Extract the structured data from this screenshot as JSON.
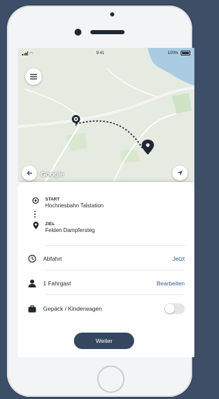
{
  "colors": {
    "primary": "#34475f",
    "link": "#3a5a8c",
    "background": "#3d4f66"
  },
  "status_bar": {
    "time": "9:41",
    "battery": "100%"
  },
  "map": {
    "attribution": "Google",
    "route": {
      "style": "dotted"
    },
    "icons": [
      "menu-icon",
      "back-arrow-icon",
      "navigation-arrow-icon",
      "start-marker-icon",
      "destination-pin-icon"
    ]
  },
  "route": {
    "start": {
      "label": "START",
      "value": "Hochriesbahn Talstation"
    },
    "destination": {
      "label": "ZIEL",
      "value": "Felden Dampfersteg"
    }
  },
  "options": {
    "departure": {
      "label": "Abfahrt",
      "action": "Jetzt"
    },
    "passengers": {
      "label": "1 Fahrgast",
      "action": "Bearbeiten"
    },
    "luggage": {
      "label": "Gepäck / Kinderwagen",
      "enabled": false
    }
  },
  "footer": {
    "continue_label": "Weiter"
  }
}
